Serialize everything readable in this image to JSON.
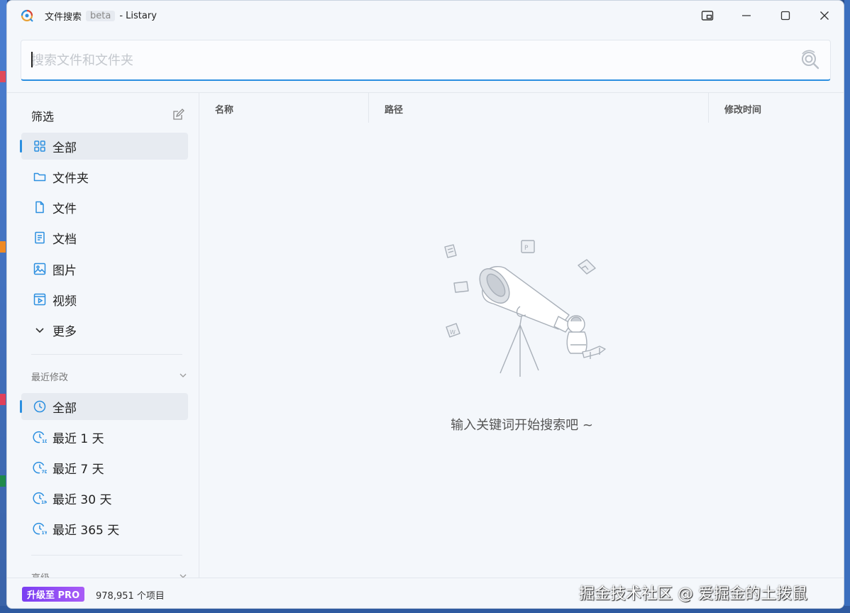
{
  "window": {
    "app_name": "文件搜索",
    "beta_tag": "beta",
    "title_suffix": "- Listary"
  },
  "search": {
    "placeholder": "搜索文件和文件夹",
    "value": ""
  },
  "sidebar": {
    "filter_title": "筛选",
    "filters": [
      {
        "label": "全部",
        "icon": "grid-icon",
        "active": true
      },
      {
        "label": "文件夹",
        "icon": "folder-icon"
      },
      {
        "label": "文件",
        "icon": "file-icon"
      },
      {
        "label": "文档",
        "icon": "document-icon"
      },
      {
        "label": "图片",
        "icon": "image-icon"
      },
      {
        "label": "视频",
        "icon": "video-icon"
      },
      {
        "label": "更多",
        "icon": "chevron-down-icon"
      }
    ],
    "recent_title": "最近修改",
    "recent": [
      {
        "label": "全部",
        "icon": "clock-icon",
        "active": true
      },
      {
        "label": "最近 1 天",
        "icon": "clock-1d-icon",
        "tag": "1D"
      },
      {
        "label": "最近 7 天",
        "icon": "clock-7d-icon",
        "tag": "7D"
      },
      {
        "label": "最近 30 天",
        "icon": "clock-1m-icon",
        "tag": "1M"
      },
      {
        "label": "最近 365 天",
        "icon": "clock-1y-icon",
        "tag": "1Y"
      }
    ],
    "advanced_title": "高级"
  },
  "columns": {
    "name": "名称",
    "path": "路径",
    "modified": "修改时间"
  },
  "empty_state": {
    "message": "输入关键词开始搜索吧 ~"
  },
  "status": {
    "pro_label": "升级至 PRO",
    "count": "978,951 个项目"
  },
  "watermark": "掘金技术社区 @ 爱掘金的土拨鼠",
  "colors": {
    "accent": "#2b8fe0",
    "pro_start": "#7a3ff2",
    "pro_end": "#a85cf6",
    "window_bg": "#f4f7fb"
  }
}
